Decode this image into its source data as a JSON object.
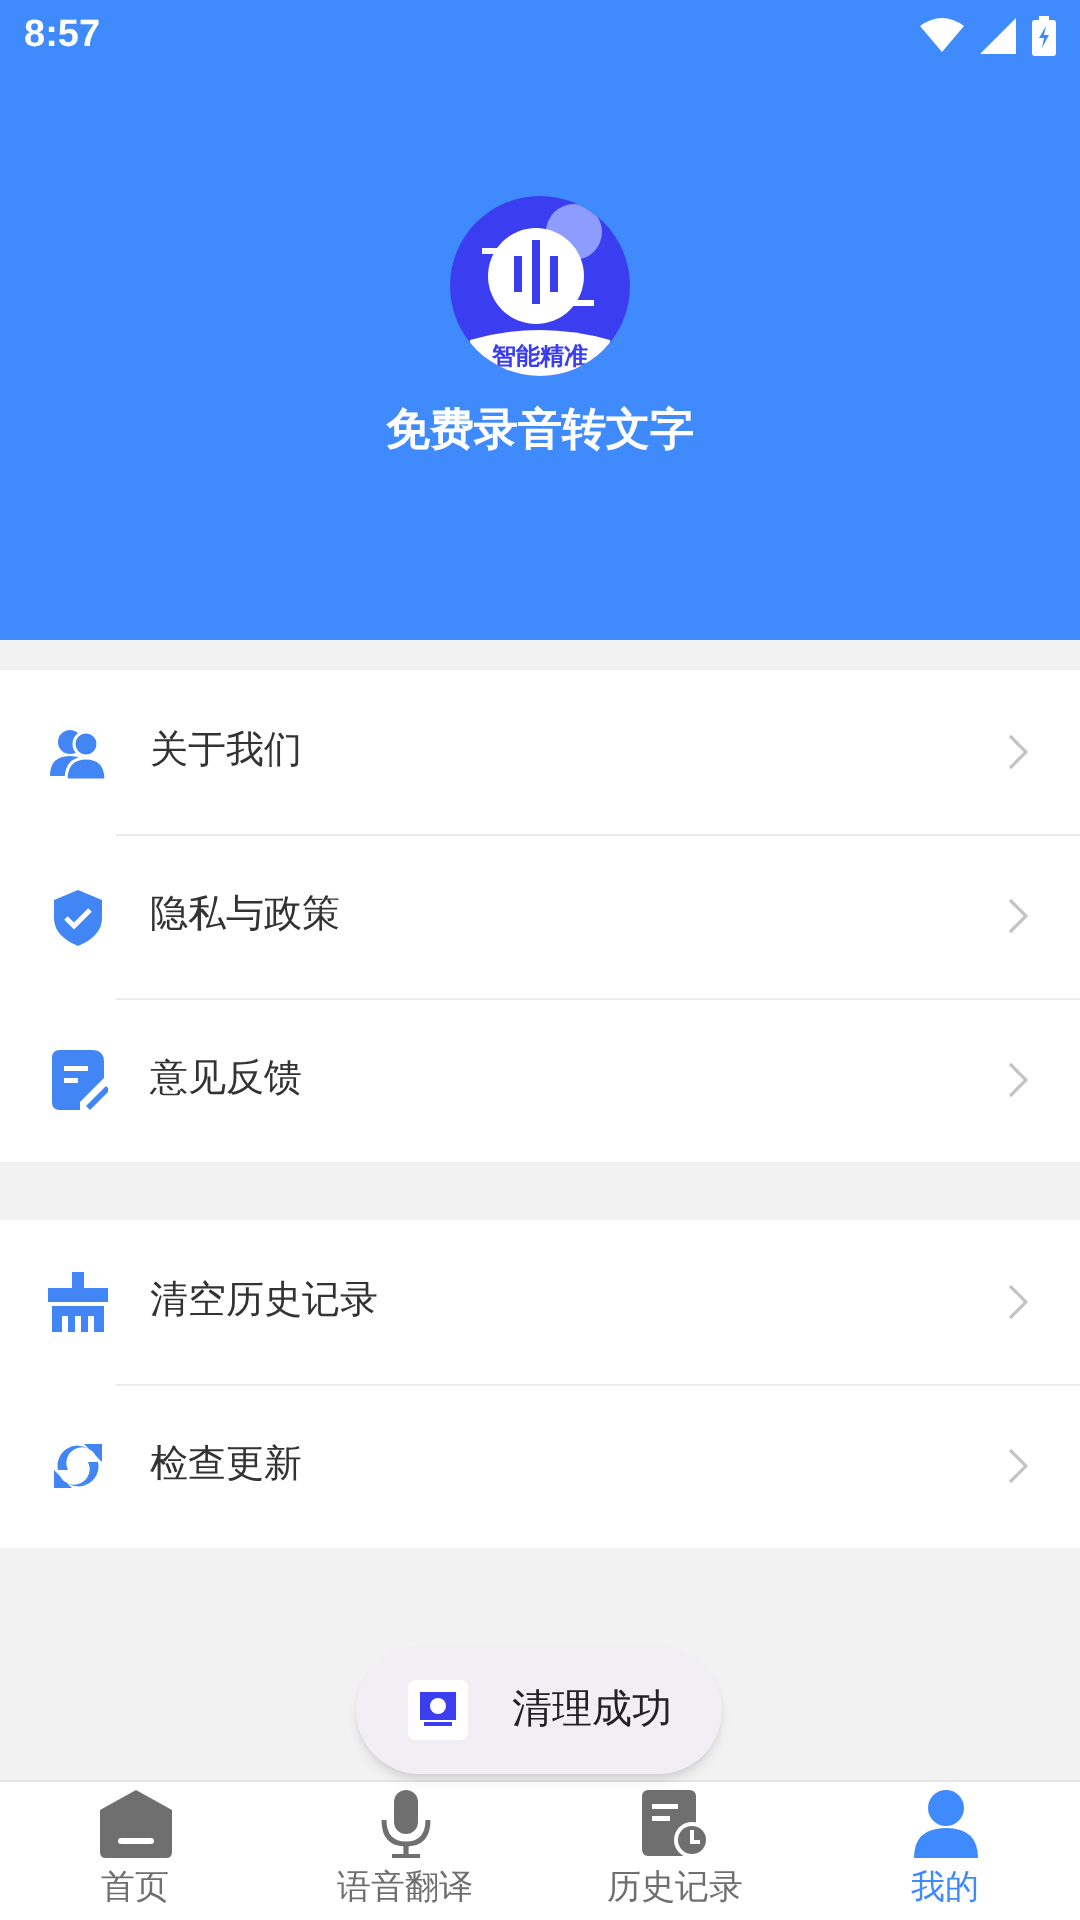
{
  "status_bar": {
    "time": "8:57"
  },
  "header": {
    "logo_badge": "智能精准",
    "title": "免费录音转文字"
  },
  "menu_groups": [
    {
      "items": [
        {
          "kind": "users",
          "label": "关于我们"
        },
        {
          "kind": "shield",
          "label": "隐私与政策"
        },
        {
          "kind": "note",
          "label": "意见反馈"
        }
      ]
    },
    {
      "items": [
        {
          "kind": "broom",
          "label": "清空历史记录"
        },
        {
          "kind": "refresh",
          "label": "检查更新"
        }
      ]
    }
  ],
  "toast": {
    "text": "清理成功"
  },
  "bottom_nav": [
    {
      "kind": "home",
      "label": "首页",
      "selected": false
    },
    {
      "kind": "mic",
      "label": "语音翻译",
      "selected": false
    },
    {
      "kind": "history",
      "label": "历史记录",
      "selected": false
    },
    {
      "kind": "user",
      "label": "我的",
      "selected": true
    }
  ]
}
